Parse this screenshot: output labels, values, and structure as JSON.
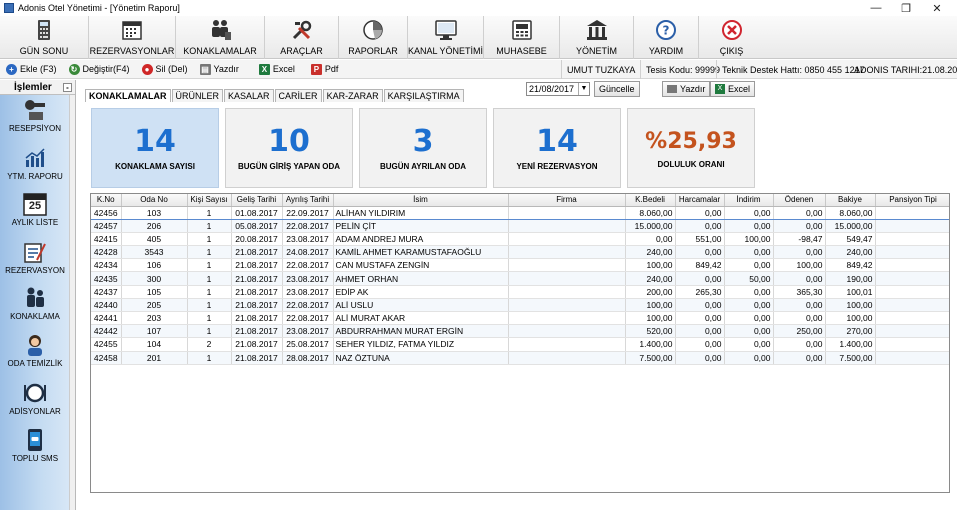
{
  "window": {
    "title": "Adonis Otel Yönetimi - [Yönetim Raporu]",
    "minimize_glyph": "—",
    "restore_glyph": "❐",
    "close_glyph": "✕"
  },
  "toolbar": [
    {
      "label": "GÜN SONU",
      "icon": "calculator-icon"
    },
    {
      "label": "REZERVASYONLAR",
      "icon": "calendar-icon"
    },
    {
      "label": "KONAKLAMALAR",
      "icon": "guests-icon"
    },
    {
      "label": "ARAÇLAR",
      "icon": "tools-icon"
    },
    {
      "label": "RAPORLAR",
      "icon": "pie-chart-icon"
    },
    {
      "label": "KANAL YÖNETİMİ",
      "icon": "monitor-icon"
    },
    {
      "label": "MUHASEBE",
      "icon": "accounting-icon"
    },
    {
      "label": "YÖNETİM",
      "icon": "building-icon"
    },
    {
      "label": "YARDIM",
      "icon": "help-icon"
    },
    {
      "label": "ÇIKIŞ",
      "icon": "exit-icon"
    }
  ],
  "actions": {
    "add": "Ekle (F3)",
    "change": "Değiştir(F4)",
    "delete": "Sil (Del)",
    "print": "Yazdır",
    "excel": "Excel",
    "pdf": "Pdf"
  },
  "status": {
    "user": "UMUT TUZKAYA",
    "facility_code": "Tesis Kodu: 99999",
    "support": "Teknik Destek Hattı: 0850 455 1217",
    "date": "ADONIS TARIHI:21.08.2017"
  },
  "sidebar": {
    "title": "İşlemler",
    "items": [
      {
        "label": "RESEPSİYON",
        "icon": "reception-icon"
      },
      {
        "label": "YTM. RAPORU",
        "icon": "bar-chart-icon"
      },
      {
        "label": "AYLIK LİSTE",
        "icon": "calendar-25-icon",
        "day": "25"
      },
      {
        "label": "REZERVASYON",
        "icon": "reservation-icon"
      },
      {
        "label": "KONAKLAMA",
        "icon": "family-icon"
      },
      {
        "label": "ODA TEMİZLİK",
        "icon": "housekeeping-icon"
      },
      {
        "label": "ADİSYONLAR",
        "icon": "dining-icon"
      },
      {
        "label": "TOPLU SMS",
        "icon": "sms-icon"
      }
    ]
  },
  "tabs": [
    "KONAKLAMALAR",
    "ÜRÜNLER",
    "KASALAR",
    "CARİLER",
    "KAR-ZARAR",
    "KARŞILAŞTIRMA"
  ],
  "controls": {
    "date": "21/08/2017",
    "refresh": "Güncelle",
    "print": "Yazdır",
    "excel": "Excel"
  },
  "cards": [
    {
      "value": "14",
      "label": "KONAKLAMA SAYISI"
    },
    {
      "value": "10",
      "label": "BUGÜN GİRİŞ YAPAN ODA"
    },
    {
      "value": "3",
      "label": "BUGÜN AYRILAN ODA"
    },
    {
      "value": "14",
      "label": "YENİ REZERVASYON"
    },
    {
      "value": "%25,93",
      "label": "DOLULUK ORANI"
    }
  ],
  "table": {
    "columns": [
      "K.No",
      "Oda No",
      "Kişi Sayısı",
      "Geliş Tarihi",
      "Ayrılış Tarihi",
      "İsim",
      "Firma",
      "K.Bedeli",
      "Harcamalar",
      "İndirim",
      "Ödenen",
      "Bakiye",
      "Pansiyon Tipi"
    ],
    "rows": [
      [
        "42456",
        "103",
        "1",
        "01.08.2017",
        "22.09.2017",
        "ALİHAN YILDIRIM",
        "",
        "8.060,00",
        "0,00",
        "0,00",
        "0,00",
        "8.060,00",
        ""
      ],
      [
        "42457",
        "206",
        "1",
        "05.08.2017",
        "22.08.2017",
        "PELİN ÇİT",
        "",
        "15.000,00",
        "0,00",
        "0,00",
        "0,00",
        "15.000,00",
        ""
      ],
      [
        "42415",
        "405",
        "1",
        "20.08.2017",
        "23.08.2017",
        "ADAM ANDREJ MURA",
        "",
        "0,00",
        "551,00",
        "100,00",
        "-98,47",
        "549,47",
        ""
      ],
      [
        "42428",
        "3543",
        "1",
        "21.08.2017",
        "24.08.2017",
        "KAMİL AHMET KARAMUSTAFAOĞLU",
        "",
        "240,00",
        "0,00",
        "0,00",
        "0,00",
        "240,00",
        ""
      ],
      [
        "42434",
        "106",
        "1",
        "21.08.2017",
        "22.08.2017",
        "CAN MUSTAFA ZENGİN",
        "",
        "100,00",
        "849,42",
        "0,00",
        "100,00",
        "849,42",
        ""
      ],
      [
        "42435",
        "300",
        "1",
        "21.08.2017",
        "23.08.2017",
        "AHMET ORHAN",
        "",
        "240,00",
        "0,00",
        "50,00",
        "0,00",
        "190,00",
        ""
      ],
      [
        "42437",
        "105",
        "1",
        "21.08.2017",
        "23.08.2017",
        "EDİP  AK",
        "",
        "200,00",
        "265,30",
        "0,00",
        "365,30",
        "100,01",
        ""
      ],
      [
        "42440",
        "205",
        "1",
        "21.08.2017",
        "22.08.2017",
        "ALİ USLU",
        "",
        "100,00",
        "0,00",
        "0,00",
        "0,00",
        "100,00",
        ""
      ],
      [
        "42441",
        "203",
        "1",
        "21.08.2017",
        "22.08.2017",
        "ALİ MURAT AKAR",
        "",
        "100,00",
        "0,00",
        "0,00",
        "0,00",
        "100,00",
        ""
      ],
      [
        "42442",
        "107",
        "1",
        "21.08.2017",
        "23.08.2017",
        "ABDURRAHMAN MURAT ERGİN",
        "",
        "520,00",
        "0,00",
        "0,00",
        "250,00",
        "270,00",
        ""
      ],
      [
        "42455",
        "104",
        "2",
        "21.08.2017",
        "25.08.2017",
        "SEHER YILDIZ, FATMA YILDIZ",
        "",
        "1.400,00",
        "0,00",
        "0,00",
        "0,00",
        "1.400,00",
        ""
      ],
      [
        "42458",
        "201",
        "1",
        "21.08.2017",
        "28.08.2017",
        "NAZ ÖZTUNA",
        "",
        "7.500,00",
        "0,00",
        "0,00",
        "0,00",
        "7.500,00",
        ""
      ]
    ]
  },
  "colors": {
    "card_number": "#1d6fcf",
    "occupancy": "#c4531e",
    "sidebar": "#9dc0e6"
  }
}
